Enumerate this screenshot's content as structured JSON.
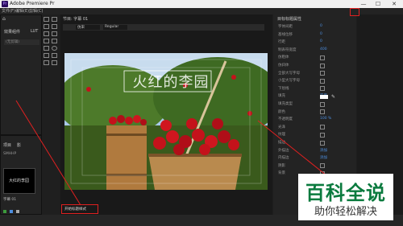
{
  "window": {
    "title": "Adobe Premiere Pr",
    "logo": "Pr",
    "minimize": "—",
    "restore": "☐",
    "close": "✕"
  },
  "menu": [
    "文件(F)",
    "编辑(E)",
    "剪辑(C)"
  ],
  "left_panel": {
    "tab": "效果组件",
    "tab2": "LUT",
    "placeholder": "(无剪辑)",
    "project_tab": "项目",
    "project_sub": "影",
    "clip_label": "字幕 01",
    "seq_label": "SMHHP",
    "thumb_text": "大红的李园"
  },
  "program": {
    "tab": "节目: 字幕 01",
    "font": "仿宋",
    "style": "Regular",
    "overlay_text": "火红的李园"
  },
  "essential_graphics": {
    "title": "目标标题属性",
    "rows": [
      {
        "label": "字体间距",
        "value": "0"
      },
      {
        "label": "基线位移",
        "value": "0"
      },
      {
        "label": "行距",
        "value": "0"
      },
      {
        "label": "制表符宽度",
        "value": "400"
      },
      {
        "label": "仿粗体",
        "value": ""
      },
      {
        "label": "仿斜体",
        "value": ""
      },
      {
        "label": "全部大写字母",
        "value": ""
      },
      {
        "label": "小型大写字母",
        "value": ""
      },
      {
        "label": "下划线",
        "value": ""
      },
      {
        "label": "填充",
        "value": "实底"
      },
      {
        "label": "填充类型",
        "value": ""
      },
      {
        "label": "颜色",
        "value": ""
      },
      {
        "label": "不透明度",
        "value": "100 %"
      },
      {
        "label": "光泽",
        "value": ""
      },
      {
        "label": "纹理",
        "value": ""
      },
      {
        "label": "描边",
        "value": ""
      },
      {
        "label": "外描边",
        "value": "添加"
      },
      {
        "label": "内描边",
        "value": "添加"
      },
      {
        "label": "阴影",
        "value": ""
      },
      {
        "label": "背景",
        "value": ""
      }
    ]
  },
  "bottom": {
    "status": "开始标题样式"
  },
  "watermark": {
    "line1": "百科全说",
    "line2": "助你轻松解决"
  },
  "colors": {
    "accent": "#4d8fe0",
    "highlight_red": "#e02020",
    "sky": "#a9c8e8",
    "leaf": "#4d7a2a",
    "apple": "#c4121b"
  }
}
